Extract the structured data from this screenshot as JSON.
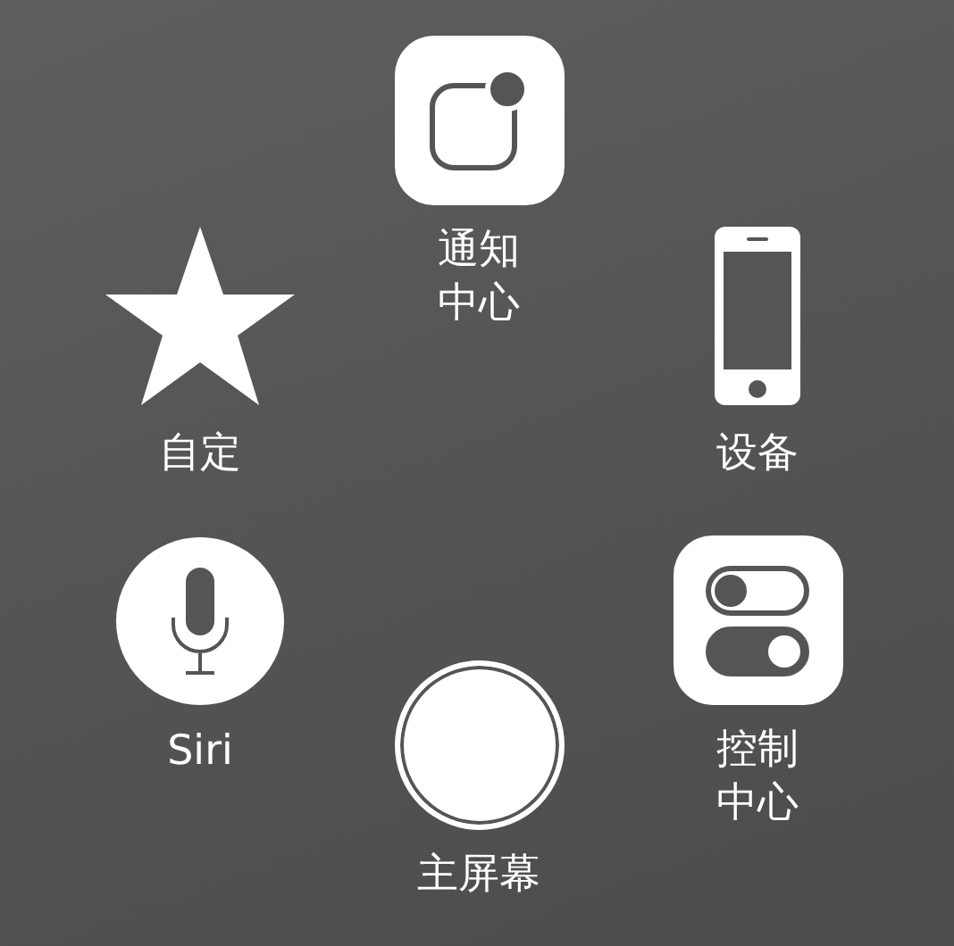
{
  "items": [
    {
      "kind": "notification",
      "label_lines": [
        "通知",
        "中心"
      ]
    },
    {
      "kind": "star",
      "label_lines": [
        "自定"
      ]
    },
    {
      "kind": "phone",
      "label_lines": [
        "设备"
      ]
    },
    {
      "kind": "mic",
      "label_lines": [
        "Siri"
      ]
    },
    {
      "kind": "toggles",
      "label_lines": [
        "控制",
        "中心"
      ],
      "toggles": [
        {
          "on": false
        },
        {
          "on": true
        }
      ]
    },
    {
      "kind": "home",
      "label_lines": [
        "主屏幕"
      ]
    }
  ]
}
